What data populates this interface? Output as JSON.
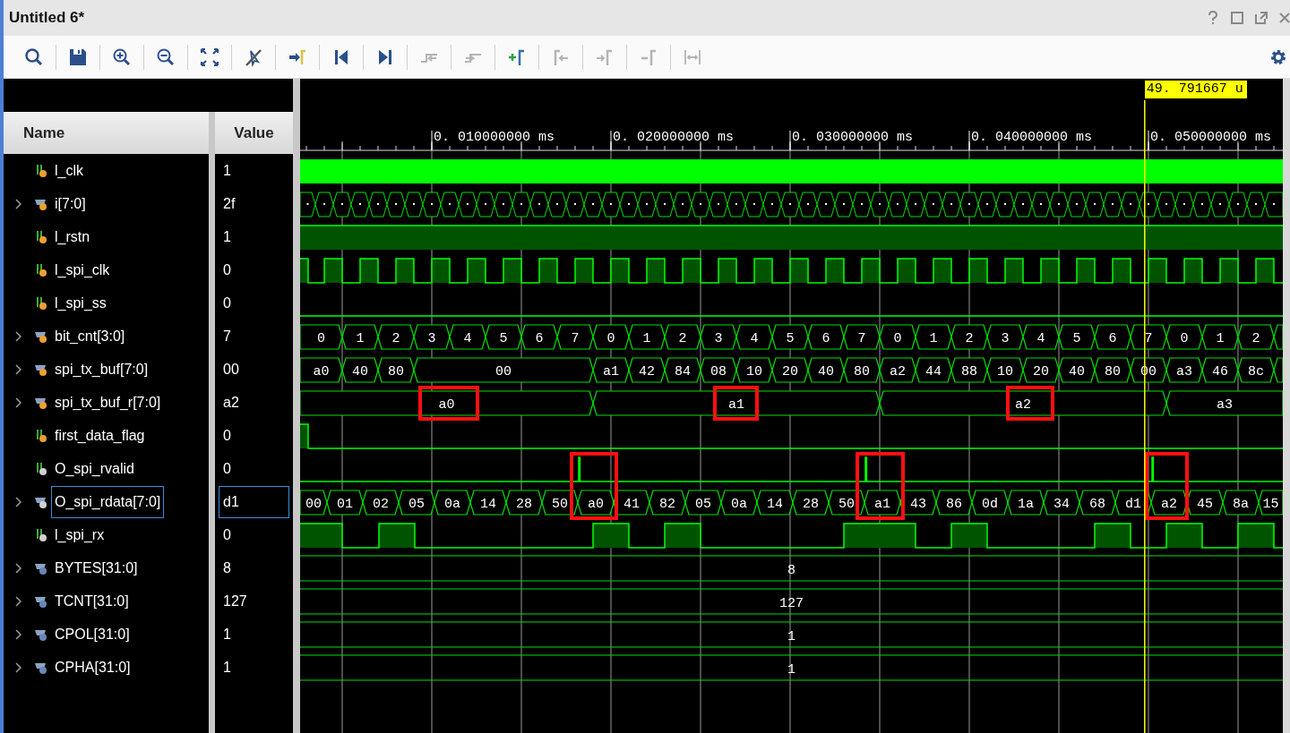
{
  "window": {
    "title": "Untitled 6*"
  },
  "toolbar": [
    {
      "kind": "zoom_fit",
      "disabled": false
    },
    {
      "kind": "save",
      "disabled": false
    },
    {
      "kind": "zoom_in",
      "disabled": false
    },
    {
      "kind": "zoom_out",
      "disabled": false
    },
    {
      "kind": "full_view",
      "disabled": false
    },
    {
      "kind": "cursor_off",
      "disabled": false
    },
    {
      "kind": "go_cursor",
      "disabled": false
    },
    {
      "kind": "go_start",
      "disabled": false
    },
    {
      "kind": "go_end",
      "disabled": false
    },
    {
      "kind": "prev_transition",
      "disabled": true
    },
    {
      "kind": "next_transition",
      "disabled": true
    },
    {
      "kind": "add_marker",
      "disabled": false
    },
    {
      "kind": "prev_marker",
      "disabled": true
    },
    {
      "kind": "next_marker",
      "disabled": true
    },
    {
      "kind": "delete_marker",
      "disabled": true
    },
    {
      "kind": "swap_cursors",
      "disabled": true
    }
  ],
  "columns": {
    "name": "Name",
    "value": "Value"
  },
  "signals": [
    {
      "name": "l_clk",
      "value": "1",
      "expandable": false,
      "kind": "reg",
      "selected": false
    },
    {
      "name": "i[7:0]",
      "value": "2f",
      "expandable": true,
      "kind": "reg",
      "selected": false
    },
    {
      "name": "l_rstn",
      "value": "1",
      "expandable": false,
      "kind": "reg",
      "selected": false
    },
    {
      "name": "l_spi_clk",
      "value": "0",
      "expandable": false,
      "kind": "reg",
      "selected": false
    },
    {
      "name": "l_spi_ss",
      "value": "0",
      "expandable": false,
      "kind": "reg",
      "selected": false
    },
    {
      "name": "bit_cnt[3:0]",
      "value": "7",
      "expandable": true,
      "kind": "reg",
      "selected": false,
      "trace": [
        "0",
        "1",
        "2",
        "3",
        "4",
        "5",
        "6",
        "7",
        "0",
        "1",
        "2",
        "3",
        "4",
        "5",
        "6",
        "7",
        "0",
        "1",
        "2",
        "3",
        "4",
        "5",
        "6",
        "7",
        "0",
        "1",
        "2"
      ]
    },
    {
      "name": "spi_tx_buf[7:0]",
      "value": "00",
      "expandable": true,
      "kind": "reg",
      "selected": false,
      "trace": [
        "a0",
        "40",
        "80",
        "00",
        "a1",
        "42",
        "84",
        "08",
        "10",
        "20",
        "40",
        "80",
        "a2",
        "44",
        "88",
        "10",
        "20",
        "40",
        "80",
        "00",
        "a3",
        "46",
        "8c"
      ]
    },
    {
      "name": "spi_tx_buf_r[7:0]",
      "value": "a2",
      "expandable": true,
      "kind": "reg",
      "selected": false,
      "trace": [
        "a0",
        "a1",
        "a2",
        "a3"
      ]
    },
    {
      "name": "first_data_flag",
      "value": "0",
      "expandable": false,
      "kind": "reg",
      "selected": false
    },
    {
      "name": "O_spi_rvalid",
      "value": "0",
      "expandable": false,
      "kind": "port",
      "selected": false
    },
    {
      "name": "O_spi_rdata[7:0]",
      "value": "d1",
      "expandable": true,
      "kind": "port",
      "selected": true,
      "trace": [
        "00",
        "01",
        "02",
        "05",
        "0a",
        "14",
        "28",
        "50",
        "a0",
        "41",
        "82",
        "05",
        "0a",
        "14",
        "28",
        "50",
        "a1",
        "43",
        "86",
        "0d",
        "1a",
        "34",
        "68",
        "d1",
        "a2",
        "45",
        "8a",
        "15"
      ]
    },
    {
      "name": "l_spi_rx",
      "value": "0",
      "expandable": false,
      "kind": "port",
      "selected": false
    },
    {
      "name": "BYTES[31:0]",
      "value": "8",
      "expandable": true,
      "kind": "param",
      "selected": false,
      "trace": [
        "8"
      ]
    },
    {
      "name": "TCNT[31:0]",
      "value": "127",
      "expandable": true,
      "kind": "param",
      "selected": false,
      "trace": [
        "127"
      ]
    },
    {
      "name": "CPOL[31:0]",
      "value": "1",
      "expandable": true,
      "kind": "param",
      "selected": false,
      "trace": [
        "1"
      ]
    },
    {
      "name": "CPHA[31:0]",
      "value": "1",
      "expandable": true,
      "kind": "param",
      "selected": false,
      "trace": [
        "1"
      ]
    }
  ],
  "ruler": {
    "labels": [
      "0. 010000000 ms",
      "0. 020000000 ms",
      "0. 030000000 ms",
      "0. 040000000 ms",
      "0. 050000000 ms"
    ]
  },
  "cursor": {
    "label": "49. 791667 u"
  }
}
